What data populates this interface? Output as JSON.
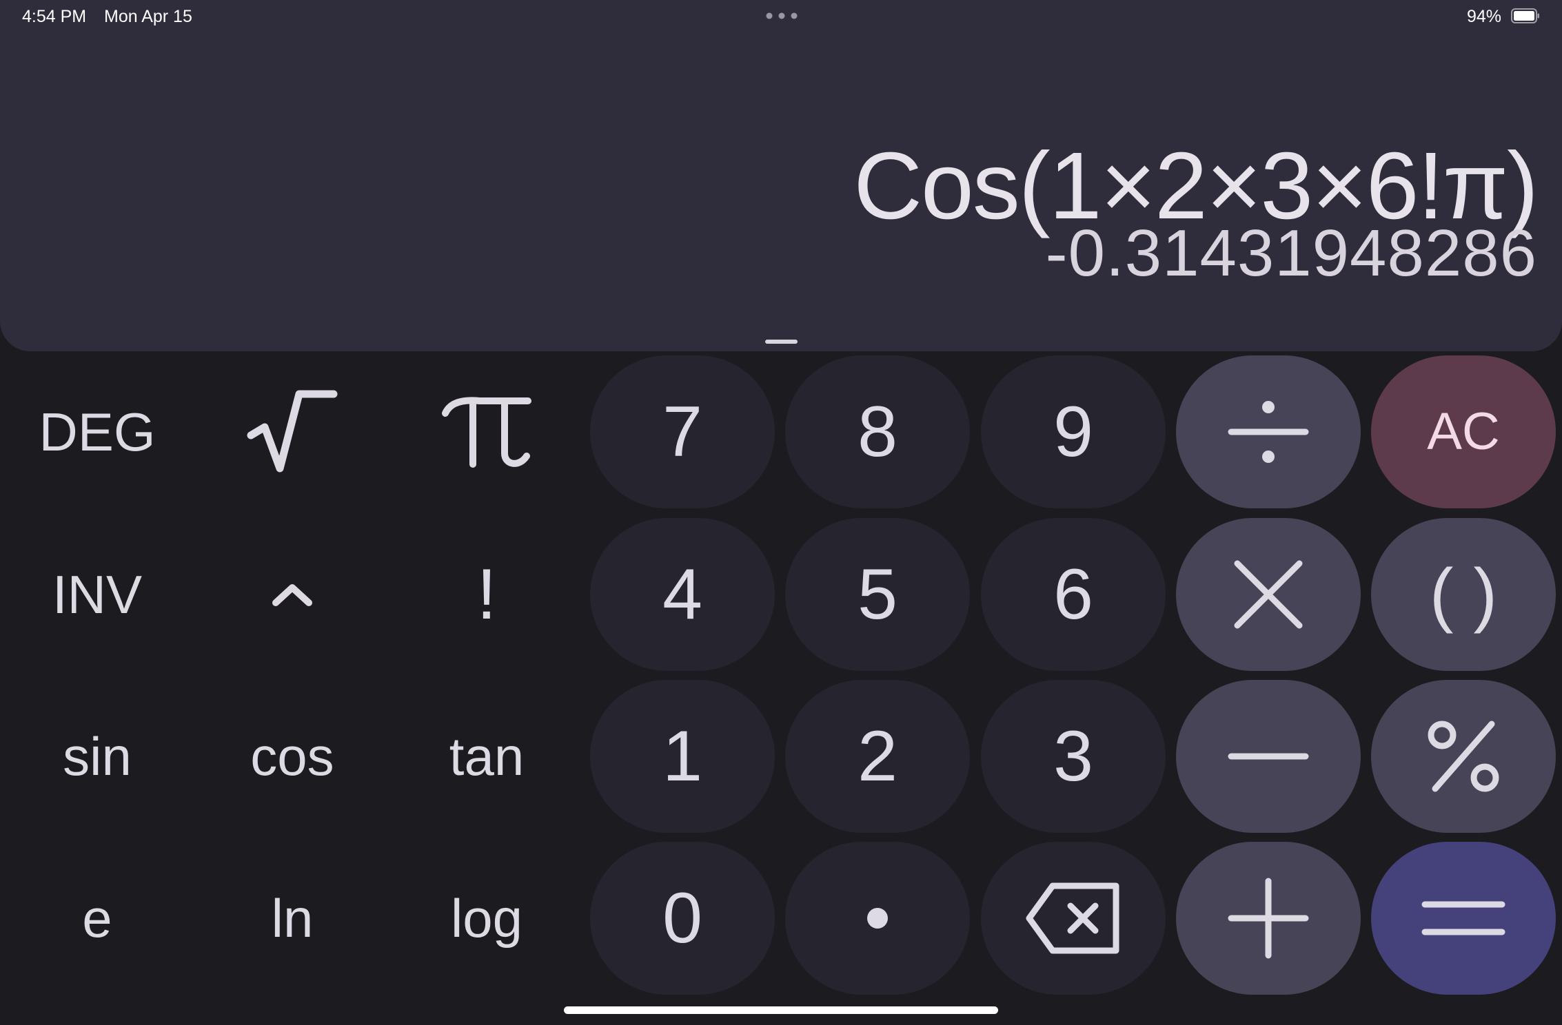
{
  "status_bar": {
    "time": "4:54 PM",
    "date": "Mon Apr 15",
    "battery_percent": "94%",
    "battery_level": 0.94
  },
  "display": {
    "expression": "Cos(1×2×3×6!π)",
    "result": "-0.31431948286"
  },
  "colors": {
    "display_bg": "#2f2d3c",
    "keypad_bg": "#1b1b20",
    "number_key": "#26242f",
    "operator_key": "#464456",
    "clear_key": "#5e3b4c",
    "equals_key": "#45417a"
  },
  "keys": {
    "deg": "DEG",
    "sqrt_icon": "square-root-icon",
    "pi_icon": "pi-icon",
    "seven": "7",
    "eight": "8",
    "nine": "9",
    "divide_icon": "divide-icon",
    "ac": "AC",
    "inv": "INV",
    "power_icon": "caret-icon",
    "factorial": "!",
    "four": "4",
    "five": "5",
    "six": "6",
    "multiply_icon": "multiply-icon",
    "parentheses": "( )",
    "sin": "sin",
    "cos": "cos",
    "tan": "tan",
    "one": "1",
    "two": "2",
    "three": "3",
    "minus_icon": "minus-icon",
    "percent_icon": "percent-icon",
    "e": "e",
    "ln": "ln",
    "log": "log",
    "zero": "0",
    "decimal_icon": "decimal-point-icon",
    "backspace_icon": "backspace-icon",
    "plus_icon": "plus-icon",
    "equals_icon": "equals-icon"
  }
}
